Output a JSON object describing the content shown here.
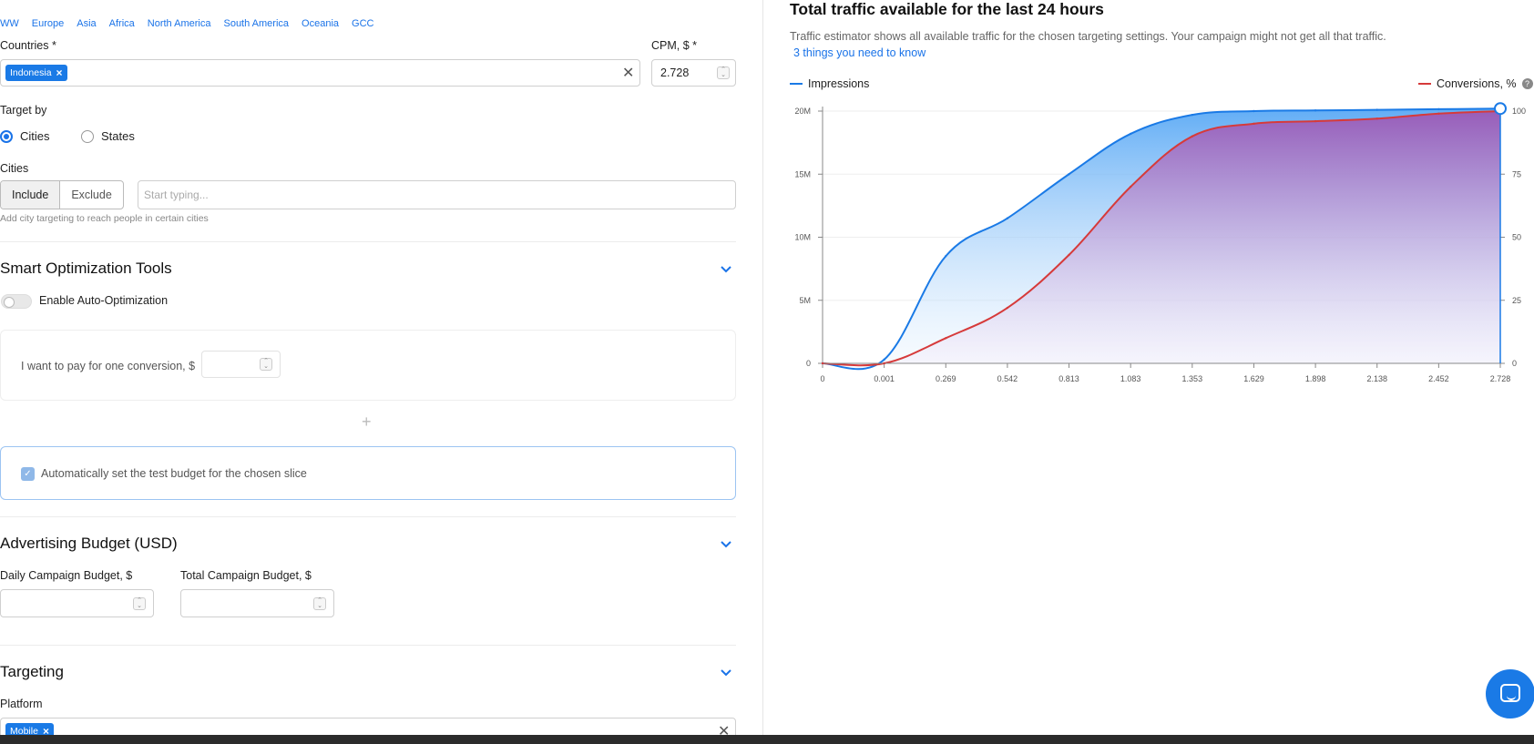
{
  "regions": [
    "WW",
    "Europe",
    "Asia",
    "Africa",
    "North America",
    "South America",
    "Oceania",
    "GCC"
  ],
  "countries": {
    "label": "Countries *",
    "chip": "Indonesia",
    "chip_remove": "×",
    "clear": "✕"
  },
  "cpm": {
    "label": "CPM, $ *",
    "value": "2.728"
  },
  "target_by": {
    "label": "Target by",
    "options": [
      "Cities",
      "States"
    ],
    "selected": "Cities"
  },
  "cities": {
    "label": "Cities",
    "include_label": "Include",
    "exclude_label": "Exclude",
    "placeholder": "Start typing...",
    "hint": "Add city targeting to reach people in certain cities"
  },
  "smart_optimization": {
    "title": "Smart Optimization Tools",
    "auto_label": "Enable Auto-Optimization",
    "conversion_label": "I want to pay for one conversion, $",
    "plus": "+",
    "test_budget_label": "Automatically set the test budget for the chosen slice",
    "check": "✓"
  },
  "advertising_budget": {
    "title": "Advertising Budget (USD)",
    "daily_label": "Daily Campaign Budget, $",
    "total_label": "Total Campaign Budget, $"
  },
  "targeting": {
    "title": "Targeting",
    "platform_label": "Platform",
    "platform_chip": "Mobile",
    "chip_remove": "×",
    "clear": "✕"
  },
  "traffic": {
    "title": "Total traffic available for the last 24 hours",
    "description": "Traffic estimator shows all available traffic for the chosen targeting settings. Your campaign might not get all that traffic.",
    "link": "3 things you need to know",
    "help": "?"
  },
  "colors": {
    "accent": "#1a73e8",
    "impressions": "#1a7ae6",
    "conversions": "#d63a3a",
    "conversions_fill": "#9b59b6"
  },
  "chart_data": {
    "type": "area",
    "x": [
      0,
      0.001,
      0.269,
      0.542,
      0.813,
      1.083,
      1.353,
      1.629,
      1.898,
      2.138,
      2.452,
      2.728
    ],
    "x_tick_labels": [
      "0",
      "0.001",
      "0.269",
      "0.542",
      "0.813",
      "1.083",
      "1.353",
      "1.629",
      "1.898",
      "2.138",
      "2.452",
      "2.728"
    ],
    "y_left_ticks": [
      "0",
      "5M",
      "10M",
      "15M",
      "20M"
    ],
    "y_left_lim": [
      0,
      20000000
    ],
    "y_right_ticks": [
      "0",
      "25",
      "50",
      "75",
      "100"
    ],
    "y_right_lim": [
      0,
      100
    ],
    "series": [
      {
        "name": "Impressions",
        "axis": "left",
        "values": [
          0,
          300000,
          8500000,
          11500000,
          15000000,
          18200000,
          19700000,
          20000000,
          20050000,
          20100000,
          20150000,
          20200000
        ]
      },
      {
        "name": "Conversions, %",
        "axis": "right",
        "values": [
          0,
          0,
          10,
          22,
          43,
          70,
          90,
          95,
          96,
          97,
          99,
          100
        ]
      }
    ],
    "grid": true,
    "legend": "top"
  }
}
